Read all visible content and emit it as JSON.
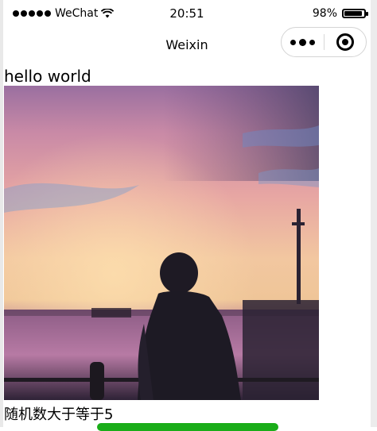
{
  "status_bar": {
    "carrier": "WeChat",
    "time": "20:51",
    "battery": "98%",
    "battery_level": 0.98
  },
  "nav": {
    "title": "Weixin"
  },
  "content": {
    "hello_text": "hello world",
    "random_text": "随机数大于等于5"
  },
  "colors": {
    "button_green": "#1aad19"
  },
  "icons": {
    "signal": "signal-dots-icon",
    "wifi": "wifi-icon",
    "battery": "battery-icon",
    "more": "more-dots-icon",
    "close": "target-close-icon"
  }
}
